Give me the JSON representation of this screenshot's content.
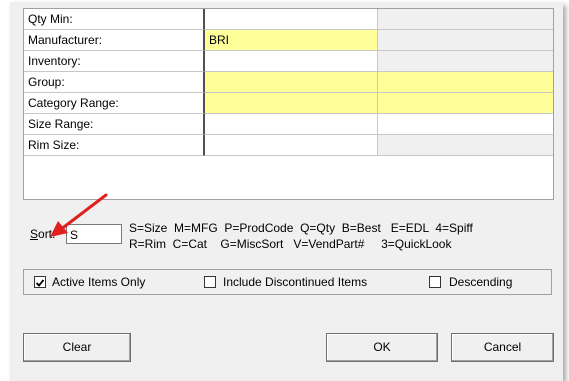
{
  "grid": {
    "rows": [
      {
        "label": "Qty Min:",
        "value": "",
        "col2": "white",
        "col3": "gray"
      },
      {
        "label": "Manufacturer:",
        "value": "BRI",
        "col2": "yellow",
        "col3": "gray"
      },
      {
        "label": "Inventory:",
        "value": "",
        "col2": "white",
        "col3": "gray"
      },
      {
        "label": "Group:",
        "value": "",
        "col2": "yellow",
        "col3": "yellow"
      },
      {
        "label": "Category Range:",
        "value": "",
        "col2": "yellow",
        "col3": "yellow"
      },
      {
        "label": "Size Range:",
        "value": "",
        "col2": "white",
        "col3": "white"
      },
      {
        "label": "Rim Size:",
        "value": "",
        "col2": "white",
        "col3": "gray"
      }
    ]
  },
  "sort": {
    "label": "Sort:",
    "value": "S",
    "codes_line1": "S=Size  M=MFG  P=ProdCode  Q=Qty  B=Best   E=EDL  4=Spiff",
    "codes_line2": "R=Rim  C=Cat    G=MiscSort   V=VendPart#     3=QuickLook"
  },
  "options": {
    "active_items_only": {
      "label": "Active Items Only",
      "checked": true
    },
    "include_discontinued": {
      "label": "Include Discontinued Items",
      "checked": false
    },
    "descending": {
      "label": "Descending",
      "checked": false
    }
  },
  "buttons": {
    "clear": "Clear",
    "ok": "OK",
    "cancel": "Cancel"
  },
  "colors": {
    "required_field": "#ffff99",
    "annotation_arrow": "#e02020"
  },
  "icons": {
    "annotation": "red-arrow-icon"
  }
}
